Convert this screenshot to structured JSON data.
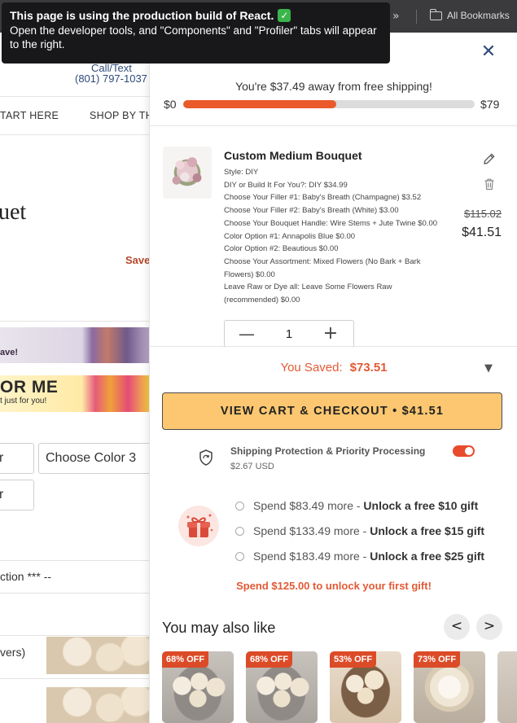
{
  "browser": {
    "chevrons": "»",
    "bookmarks_label": "All Bookmarks"
  },
  "react_tooltip": {
    "title": "This page is using the production build of React.",
    "body": "Open the developer tools, and \"Components\" and \"Profiler\" tabs will appear to the right."
  },
  "background_page": {
    "call_label": "Call/Text",
    "phone": "(801) 797-1037",
    "nav_start": "TART HERE",
    "nav_shop": "SHOP BY TH",
    "title_fragment": "uet",
    "save_fragment": "Save",
    "banner1_text": "ave!",
    "banner2_big": "OR ME",
    "banner2_small": "t just for you!",
    "select_color_3": "Choose Color 3",
    "select_partial": "r",
    "select_partial_2": "r",
    "section_text": "ction *** --",
    "row_text": "vers)"
  },
  "cart": {
    "shipping_message": "You're $37.49 away from free shipping!",
    "shipping_min": "$0",
    "shipping_max": "$79",
    "shipping_progress": 0.526,
    "item": {
      "title": "Custom Medium Bouquet",
      "options": [
        "Style: DIY",
        "DIY or Build It For You?: DIY $34.99",
        "Choose Your Filler #1: Baby's Breath (Champagne) $3.52",
        "Choose Your Filler #2: Baby's Breath (White) $3.00",
        "Choose Your Bouquet Handle: Wire Stems + Jute Twine $0.00",
        "Color Option #1: Annapolis Blue $0.00",
        "Color Option #2: Beautious $0.00",
        "Choose Your Assortment: Mixed Flowers (No Bark + Bark Flowers) $0.00",
        "Leave Raw or Dye all: Leave Some Flowers Raw (recommended) $0.00"
      ],
      "price_original": "$115.02",
      "price_current": "$41.51",
      "quantity": "1"
    },
    "saved_label": "You Saved:",
    "saved_amount": "$73.51",
    "checkout_label": "VIEW CART & CHECKOUT • $41.51",
    "protection": {
      "title": "Shipping Protection & Priority Processing",
      "price": "$2.67 USD",
      "enabled": true
    },
    "gifts": [
      {
        "prefix": "Spend $83.49 more - ",
        "reward": "Unlock a free $10 gift"
      },
      {
        "prefix": "Spend $133.49 more - ",
        "reward": "Unlock a free $15 gift"
      },
      {
        "prefix": "Spend $183.49 more - ",
        "reward": "Unlock a free $25 gift"
      }
    ],
    "gift_note": "Spend $125.00 to unlock your first gift!",
    "also_like_title": "You may also like",
    "prev_label": "<",
    "next_label": ">",
    "products": [
      {
        "badge": "68% OFF"
      },
      {
        "badge": "68% OFF"
      },
      {
        "badge": "53% OFF"
      },
      {
        "badge": "73% OFF"
      }
    ]
  },
  "colors": {
    "accent_orange": "#e25a35",
    "progress_fill": "#ea5a2a",
    "checkout_bg": "#fcc770",
    "toggle_on": "#e84c2c",
    "brand_navy": "#2d4a7a"
  }
}
